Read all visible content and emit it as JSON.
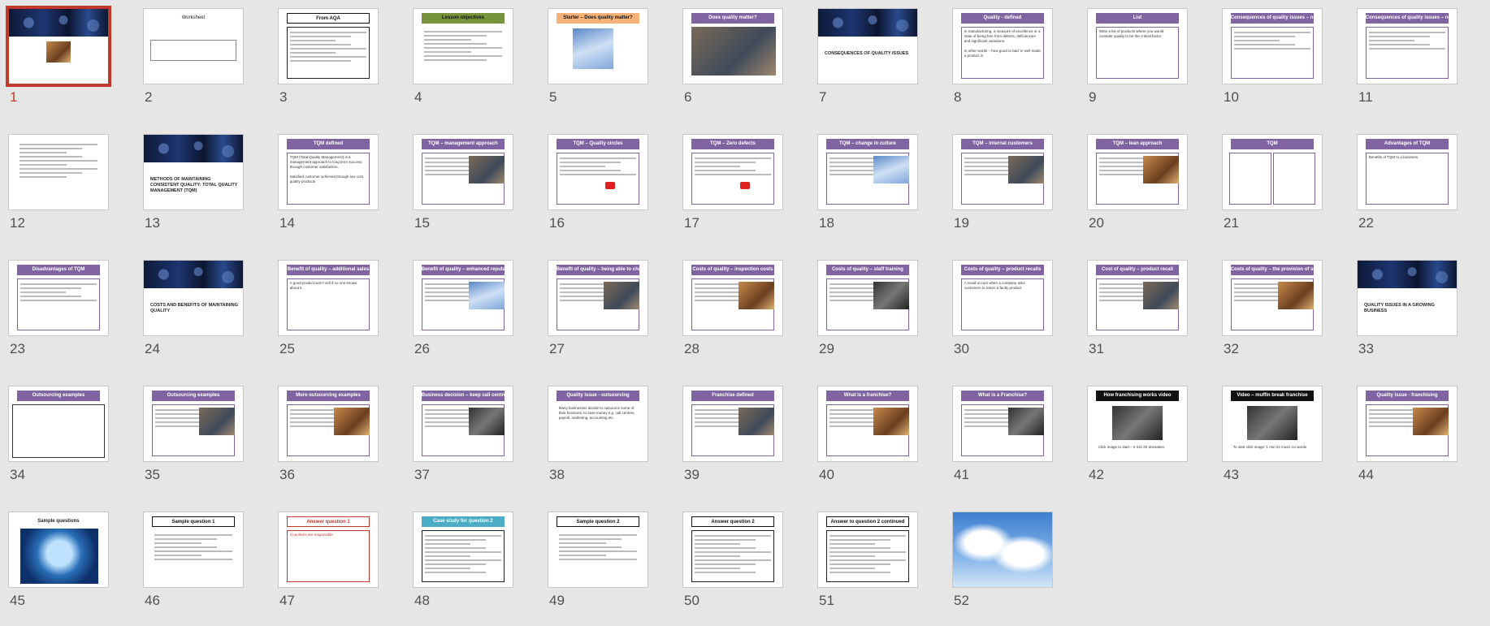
{
  "app": "Slide Sorter",
  "selected_slide": 1,
  "slides": [
    {
      "n": "1",
      "title": ""
    },
    {
      "n": "2",
      "title": "Worksheet"
    },
    {
      "n": "3",
      "title": "From AQA"
    },
    {
      "n": "4",
      "title": "Lesson objectives"
    },
    {
      "n": "5",
      "title": "Starter – Does quality matter?"
    },
    {
      "n": "6",
      "title": "Does quality matter?"
    },
    {
      "n": "7",
      "title": "CONSEQUENCES OF QUALITY ISSUES"
    },
    {
      "n": "8",
      "title": "Quality - defined"
    },
    {
      "n": "9",
      "title": "List"
    },
    {
      "n": "10",
      "title": "Consequences of quality issues – not meeting customer expectations"
    },
    {
      "n": "11",
      "title": "Consequences of quality issues – not meeting customer expectations"
    },
    {
      "n": "12",
      "title": ""
    },
    {
      "n": "13",
      "title": "METHODS OF MAINTAINING CONSISTENT QUALITY: TOTAL QUALITY MANAGEMENT (TQM)"
    },
    {
      "n": "14",
      "title": "TQM defined"
    },
    {
      "n": "15",
      "title": "TQM – management approach"
    },
    {
      "n": "16",
      "title": "TQM – Quality circles"
    },
    {
      "n": "17",
      "title": "TQM – Zero defects"
    },
    {
      "n": "18",
      "title": "TQM – change in culture"
    },
    {
      "n": "19",
      "title": "TQM – internal customers"
    },
    {
      "n": "20",
      "title": "TQM – lean approach"
    },
    {
      "n": "21",
      "title": "TQM"
    },
    {
      "n": "22",
      "title": "Advantages of TQM"
    },
    {
      "n": "23",
      "title": "Disadvantages of TQM"
    },
    {
      "n": "24",
      "title": "COSTS AND BENEFITS OF MAINTAINING QUALITY"
    },
    {
      "n": "25",
      "title": "Benefit of quality – additional sales"
    },
    {
      "n": "26",
      "title": "Benefit of quality – enhanced reputation"
    },
    {
      "n": "27",
      "title": "Benefit of quality – being able to charge a higher price"
    },
    {
      "n": "28",
      "title": "Costs of quality – inspection costs"
    },
    {
      "n": "29",
      "title": "Costs of quality – staff training"
    },
    {
      "n": "30",
      "title": "Costs of quality – product recalls"
    },
    {
      "n": "31",
      "title": "Cost of quality – product recall"
    },
    {
      "n": "32",
      "title": "Costs of quality – the provision of services"
    },
    {
      "n": "33",
      "title": "QUALITY ISSUES IN A GROWING BUSINESS"
    },
    {
      "n": "34",
      "title": "Outsourcing examples"
    },
    {
      "n": "35",
      "title": "Outsourcing examples"
    },
    {
      "n": "36",
      "title": "More outsourcing examples"
    },
    {
      "n": "37",
      "title": "Business decision – keep call centre in UK or move it to India?"
    },
    {
      "n": "38",
      "title": "Quality issue - outsourcing"
    },
    {
      "n": "39",
      "title": "Franchise defined"
    },
    {
      "n": "40",
      "title": "What is a franchise?"
    },
    {
      "n": "41",
      "title": "What is a Franchise?"
    },
    {
      "n": "42",
      "title": "How franchising works video"
    },
    {
      "n": "43",
      "title": "Video – muffin break franchise"
    },
    {
      "n": "44",
      "title": "Quality issue - franchising"
    },
    {
      "n": "45",
      "title": "Sample questions"
    },
    {
      "n": "46",
      "title": "Sample question 1"
    },
    {
      "n": "47",
      "title": "Answer question 1"
    },
    {
      "n": "48",
      "title": "Case study for question 2"
    },
    {
      "n": "49",
      "title": "Sample question 2"
    },
    {
      "n": "50",
      "title": "Answer question 2"
    },
    {
      "n": "51",
      "title": "Answer to question 2 continued"
    },
    {
      "n": "52",
      "title": ""
    }
  ],
  "snippets": {
    "s8": "In manufacturing, a measure of excellence or a state of being free from defects, deficiencies and significant variations.",
    "s8b": "In other words – how good or bad ‘a’ well made a product is",
    "s14": "TQM (Total Quality Management) is a management approach to long term success through customer satisfaction.",
    "s14b": "Satisfied customer achieved through low cost quality products",
    "s25": "A good product won’t sell if no one knows about it.",
    "s38": "Many businesses decide to outsource some of their functions, to save money e.g. call centres, payroll, marketing, accounting etc.",
    "s47": "2) workers are responsible",
    "s9": "Write a list of products where you would consider quality to be the critical factor",
    "s22": "Benefits of TQM to a business",
    "s30": "A recall occurs when a company asks customers to return a faulty product",
    "s42": "Click image to start – 5 min 20 animation",
    "s43": "To start click image: 1 min 22 music no words"
  }
}
